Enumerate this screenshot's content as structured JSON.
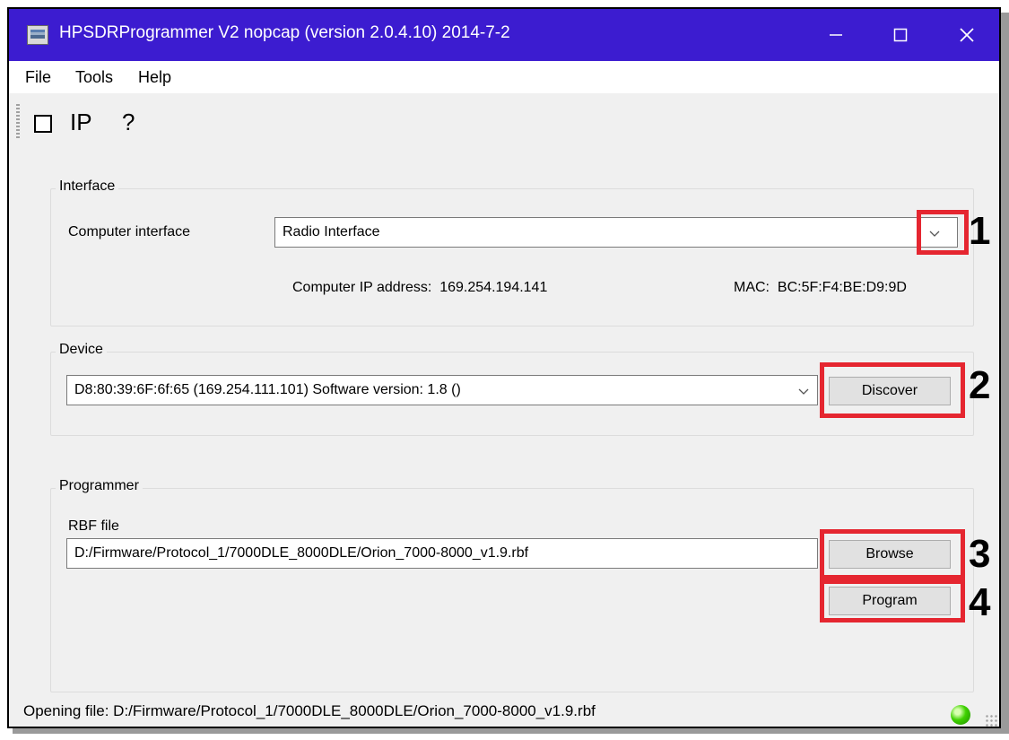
{
  "window": {
    "title": "HPSDRProgrammer V2 nopcap (version 2.0.4.10) 2014-7-2",
    "titlebar_color": "#3c1cd0"
  },
  "menu": {
    "file": "File",
    "tools": "Tools",
    "help": "Help"
  },
  "toolbar": {
    "ip": "IP",
    "help": "?"
  },
  "interface": {
    "group_label": "Interface",
    "computer_interface_label": "Computer interface",
    "computer_interface_value": "Radio Interface",
    "ip_label": "Computer IP address:",
    "ip_value": "169.254.194.141",
    "mac_label": "MAC:",
    "mac_value": "BC:5F:F4:BE:D9:9D"
  },
  "device": {
    "group_label": "Device",
    "selected": "D8:80:39:6F:6f:65 (169.254.111.101) Software version: 1.8 ()",
    "discover_label": "Discover"
  },
  "programmer": {
    "group_label": "Programmer",
    "rbf_label": "RBF file",
    "rbf_path": "D:/Firmware/Protocol_1/7000DLE_8000DLE/Orion_7000-8000_v1.9.rbf",
    "browse_label": "Browse",
    "program_label": "Program"
  },
  "annotations": {
    "n1": "1",
    "n2": "2",
    "n3": "3",
    "n4": "4",
    "box_color": "#e52630"
  },
  "status": {
    "text": "Opening file: D:/Firmware/Protocol_1/7000DLE_8000DLE/Orion_7000-8000_v1.9.rbf",
    "led_color": "#3fd200"
  }
}
